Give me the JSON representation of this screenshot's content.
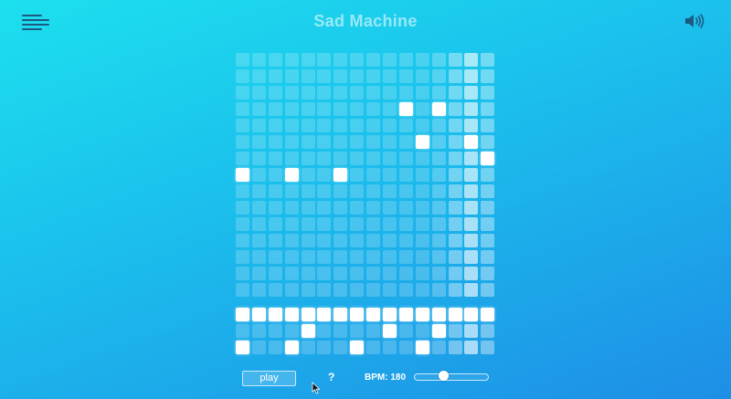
{
  "header": {
    "title": "Sad Machine",
    "menu_icon": "hamburger-menu-icon",
    "volume_icon": "speaker-volume-icon"
  },
  "melody_grid": {
    "columns": 16,
    "rows": 15,
    "playhead_column": 14,
    "active_cells": [
      [
        3,
        10
      ],
      [
        3,
        12
      ],
      [
        5,
        11
      ],
      [
        5,
        14
      ],
      [
        6,
        15
      ],
      [
        7,
        0
      ],
      [
        7,
        3
      ],
      [
        7,
        6
      ]
    ]
  },
  "drum_grid": {
    "columns": 16,
    "rows": 3,
    "playhead_column": 14,
    "active_cells": [
      [
        0,
        0
      ],
      [
        0,
        1
      ],
      [
        0,
        2
      ],
      [
        0,
        3
      ],
      [
        0,
        4
      ],
      [
        0,
        5
      ],
      [
        0,
        6
      ],
      [
        0,
        7
      ],
      [
        0,
        8
      ],
      [
        0,
        9
      ],
      [
        0,
        10
      ],
      [
        0,
        11
      ],
      [
        0,
        12
      ],
      [
        0,
        13
      ],
      [
        0,
        14
      ],
      [
        0,
        15
      ],
      [
        1,
        4
      ],
      [
        1,
        9
      ],
      [
        1,
        12
      ],
      [
        2,
        0
      ],
      [
        2,
        3
      ],
      [
        2,
        7
      ],
      [
        2,
        11
      ]
    ]
  },
  "controls": {
    "play_label": "play",
    "help_label": "?",
    "bpm_label": "BPM: 180",
    "bpm_slider_fraction": 0.4
  },
  "colors": {
    "background_top": "#1ce0ee",
    "background_bottom": "#1e8ee6",
    "cell_on": "#ffffff",
    "menu_icon": "#1d5a82",
    "volume_icon": "#1d5a82"
  }
}
